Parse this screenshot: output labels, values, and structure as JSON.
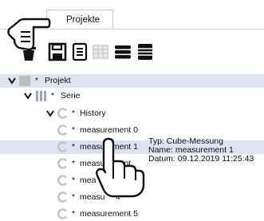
{
  "tab": {
    "label": "Projekte"
  },
  "toolbar": {
    "icons": [
      "trash-icon",
      "save-icon",
      "document-icon",
      "grid-icon",
      "database-icon",
      "list-icon"
    ]
  },
  "tree": {
    "rows": [
      {
        "star": "*",
        "label": "Projekt"
      },
      {
        "star": "*",
        "label": "Serie"
      },
      {
        "star": "*",
        "label": "History"
      },
      {
        "star": "*",
        "label": "measurement 0"
      },
      {
        "star": "*",
        "label": "measurement 1"
      },
      {
        "star": "*",
        "label": "measurement"
      },
      {
        "star": "*",
        "label": "mea"
      },
      {
        "star": "*",
        "label": "measu"
      },
      {
        "star": "*",
        "label": "measurement 5"
      }
    ],
    "row4_suffix": "4"
  },
  "tooltip": {
    "type": "Typ: Cube-Messung",
    "name": "Name: measurement 1",
    "date": "Datum: 09.12.2019 11:25:43"
  },
  "colors": {
    "selection": "#dbe3f0",
    "icon_dark": "#111111",
    "c_icon": "#c4c4c4",
    "project_square": "#bdbdbd",
    "serie_bars": "#9aa7b5"
  }
}
